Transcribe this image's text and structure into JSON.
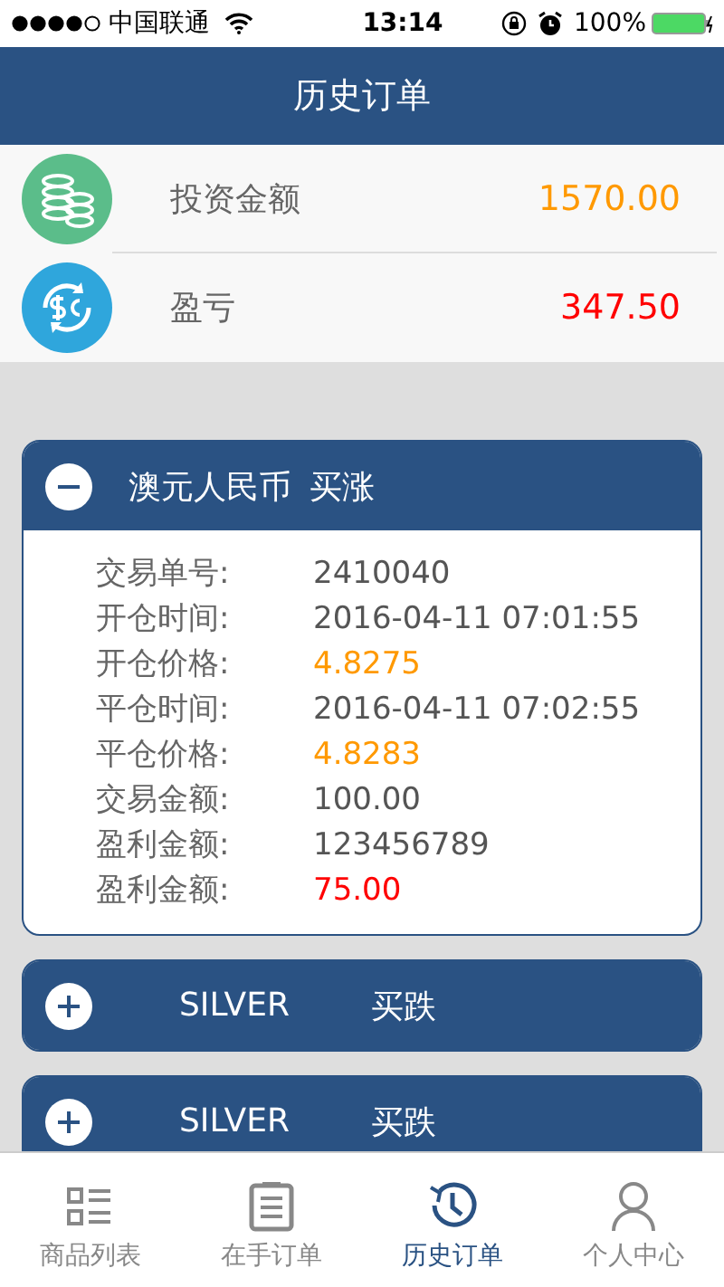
{
  "status_bar": {
    "carrier": "中国联通",
    "time": "13:14",
    "battery": "100%"
  },
  "nav": {
    "title": "历史订单"
  },
  "summary": [
    {
      "kind": "invest",
      "label": "投资金额",
      "value": "1570.00"
    },
    {
      "kind": "profit",
      "label": "盈亏",
      "value": "347.50"
    }
  ],
  "orders": [
    {
      "name": "澳元人民币",
      "direction": "买涨",
      "expanded": true,
      "fields": [
        {
          "label": "交易单号:",
          "value": "2410040",
          "kind": "plain"
        },
        {
          "label": "开仓时间:",
          "value": "2016-04-11 07:01:55",
          "kind": "plain"
        },
        {
          "label": "开仓价格:",
          "value": "4.8275",
          "kind": "price"
        },
        {
          "label": "平仓时间:",
          "value": "2016-04-11 07:02:55",
          "kind": "plain"
        },
        {
          "label": "平仓价格:",
          "value": "4.8283",
          "kind": "price"
        },
        {
          "label": "交易金额:",
          "value": "100.00",
          "kind": "plain"
        },
        {
          "label": "盈利金额:",
          "value": "123456789",
          "kind": "plain"
        },
        {
          "label": "盈利金额:",
          "value": "75.00",
          "kind": "profit"
        }
      ]
    },
    {
      "name": "SILVER",
      "direction": "买跌",
      "expanded": false
    },
    {
      "name": "SILVER",
      "direction": "买跌",
      "expanded": false
    }
  ],
  "tabs": [
    {
      "kind": "list",
      "label": "商品列表",
      "selected": false
    },
    {
      "kind": "clipboard",
      "label": "在手订单",
      "selected": false
    },
    {
      "kind": "history",
      "label": "历史订单",
      "selected": true
    },
    {
      "kind": "person",
      "label": "个人中心",
      "selected": false
    }
  ]
}
